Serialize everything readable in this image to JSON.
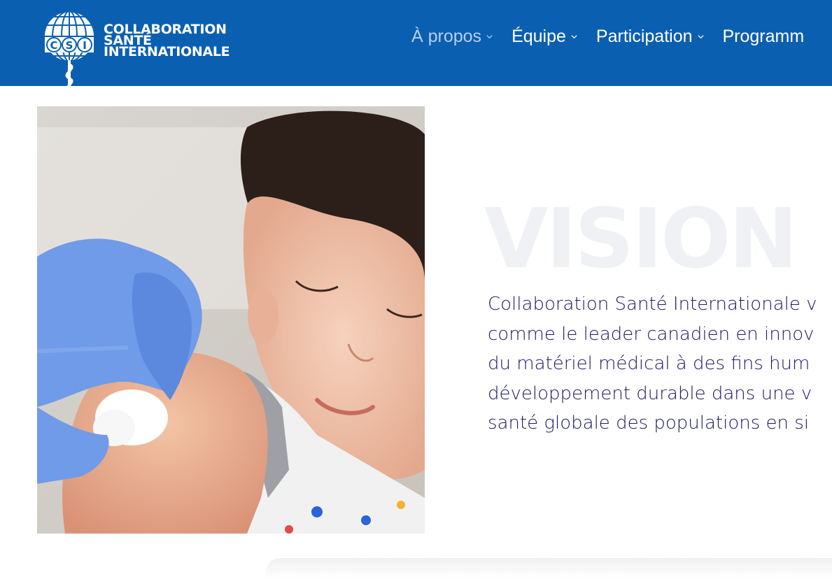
{
  "brand": {
    "line1": "COLLABORATION",
    "line2": "SANTÉ",
    "line3": "INTERNATIONALE",
    "emblem_letters": [
      "C",
      "S",
      "I"
    ]
  },
  "nav": {
    "items": [
      {
        "label": "À propos",
        "active": true
      },
      {
        "label": "Équipe",
        "active": false
      },
      {
        "label": "Participation",
        "active": false
      },
      {
        "label": "Programm",
        "active": false
      }
    ]
  },
  "vision": {
    "heading": "VISION",
    "lines": [
      "Collaboration Santé Internationale v",
      "comme le leader canadien en innov",
      "du matériel médical à des fins hum",
      "développement durable dans une v",
      "santé globale des populations en si"
    ]
  },
  "colors": {
    "header_bg": "#0b5fb0",
    "nav_active": "#b7cfee",
    "body_text": "#1f1a66",
    "watermark": "#f0f1f5",
    "glove": "#6f9be8"
  },
  "icons": {
    "nav_dropdown": "chevron-down-icon",
    "logo": "globe-caduceus-icon"
  }
}
